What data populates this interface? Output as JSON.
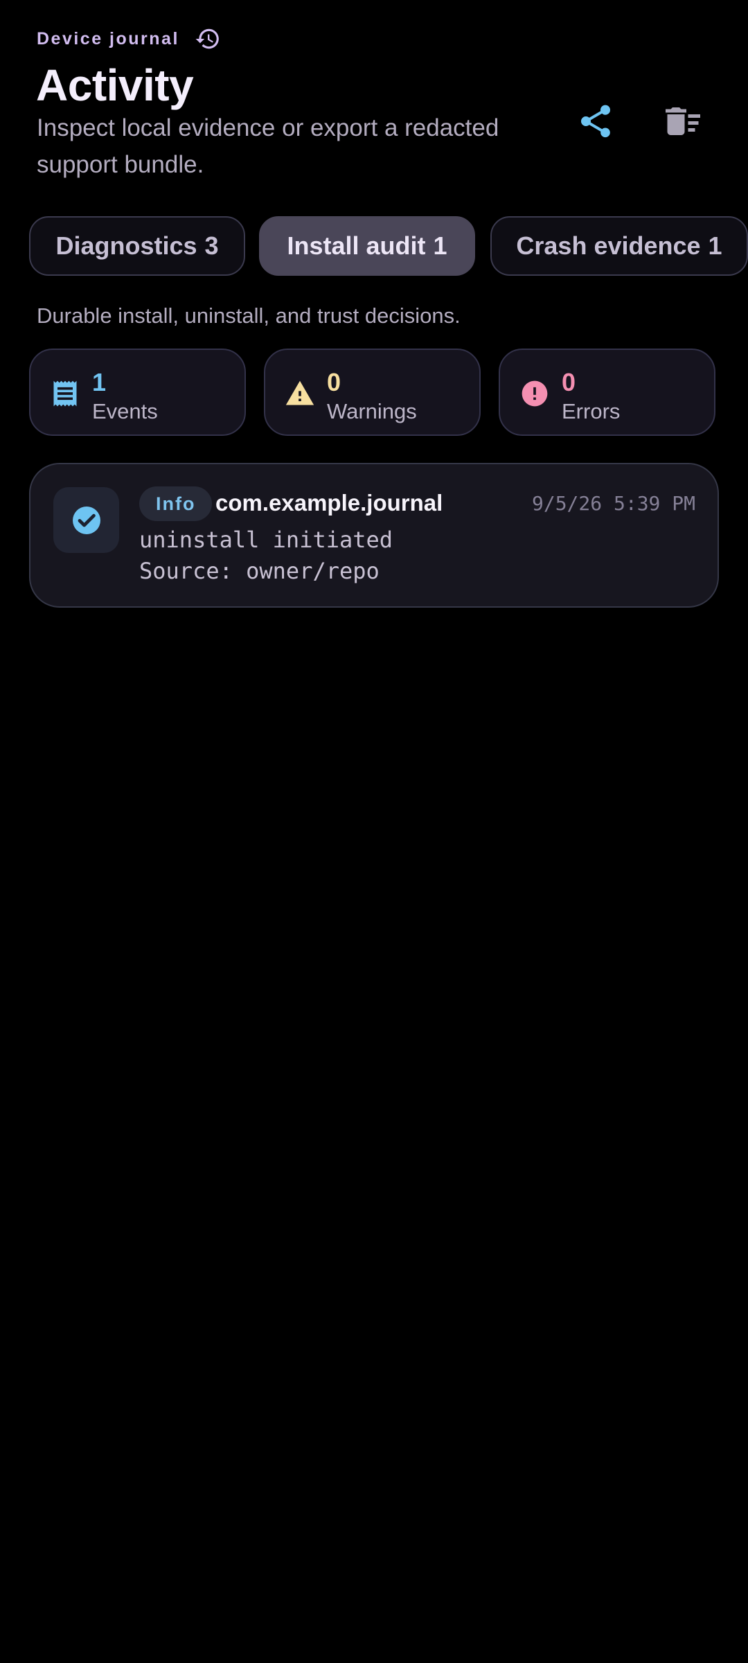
{
  "header": {
    "eyebrow": "Device journal",
    "title": "Activity",
    "subtitle": "Inspect local evidence or export a redacted support bundle.",
    "actions": [
      {
        "icon": "share-icon",
        "color": "#6ec4f2"
      },
      {
        "icon": "clear-all-icon",
        "color": "#a9a4b4"
      }
    ]
  },
  "tabs": [
    {
      "label": "Diagnostics",
      "count": "3",
      "selected": false
    },
    {
      "label": "Install audit",
      "count": "1",
      "selected": true
    },
    {
      "label": "Crash evidence",
      "count": "1",
      "selected": false
    }
  ],
  "caption": "Durable install, uninstall, and trust decisions.",
  "stats": [
    {
      "value": "1",
      "label": "Events",
      "icon": "receipt-icon",
      "color": "#72c4f2"
    },
    {
      "value": "0",
      "label": "Warnings",
      "icon": "warning-icon",
      "color": "#f7dfa0"
    },
    {
      "value": "0",
      "label": "Errors",
      "icon": "error-icon",
      "color": "#f48fb1"
    }
  ],
  "entries": [
    {
      "icon": "check-circle-icon",
      "severity": "Info",
      "package": "com.example.journal",
      "timestamp": "9/5/26 5:39 PM",
      "lines": [
        "uninstall initiated",
        "Source: owner/repo"
      ]
    }
  ],
  "colors": {
    "accent": "#6ec4f2",
    "eyebrow": "#d2bdf0",
    "background": "#000000",
    "surface": "#15131e",
    "selected_tab": "#4a4658"
  }
}
